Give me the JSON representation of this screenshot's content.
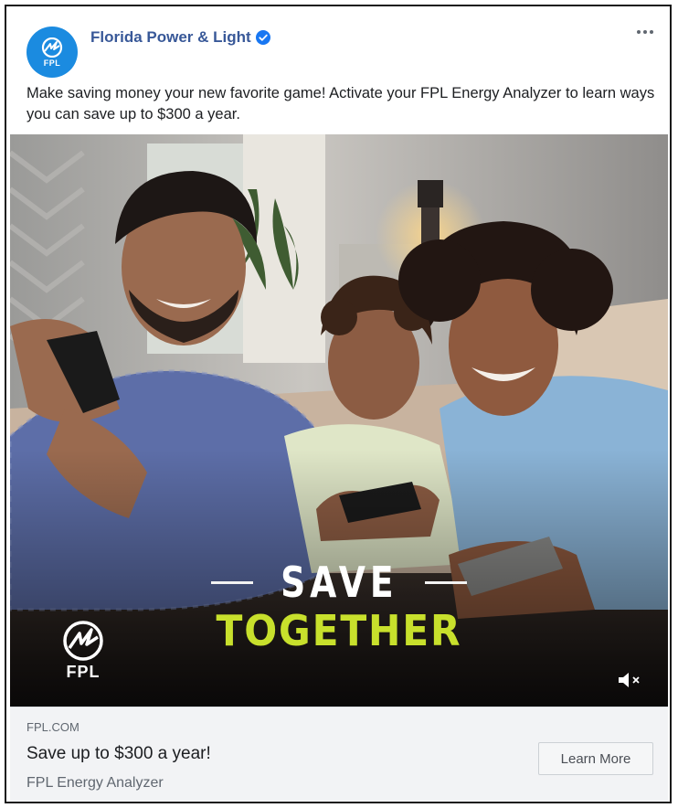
{
  "header": {
    "page_name": "Florida Power & Light",
    "avatar_label": "FPL",
    "verified": true
  },
  "post": {
    "text": "Make saving money your new favorite game! Activate your FPL Energy Analyzer to learn ways you can save up to $300 a year."
  },
  "media": {
    "headline_top": "SAVE",
    "headline_bottom": "TOGETHER",
    "logo_text": "FPL",
    "mute_icon": "speaker-muted-icon",
    "accent_color": "#c8e02c"
  },
  "link_preview": {
    "domain": "FPL.COM",
    "title": "Save up to $300 a year!",
    "description": "FPL Energy Analyzer",
    "cta_label": "Learn More"
  },
  "colors": {
    "brand_blue": "#1b8be0",
    "page_name": "#385898",
    "footer_bg": "#f2f3f5"
  }
}
